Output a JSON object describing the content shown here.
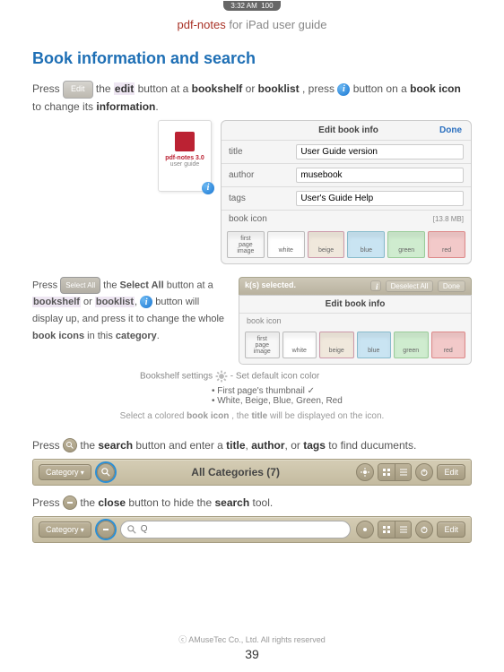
{
  "status_bar": {
    "time": "3:32 AM",
    "battery": "100"
  },
  "header": {
    "brand": "pdf-notes",
    "suffix": "for iPad user guide"
  },
  "section_title": "Book information and search",
  "p1": {
    "pre": "Press ",
    "chip": "Edit",
    "mid1": " the ",
    "b1": "edit",
    "mid2": " button at a ",
    "b2": "bookshelf",
    "mid3": " or ",
    "b3": "booklist",
    "mid4": ", press ",
    "mid5": " button on a ",
    "b4": "book icon",
    "mid6": " to change its ",
    "b5": "information",
    "end": "."
  },
  "thumb": {
    "line1": "pdf-notes 3.0",
    "line2": "user guide"
  },
  "edit_panel": {
    "title": "Edit book info",
    "done": "Done",
    "rows": {
      "title_label": "title",
      "title_value": "User Guide version",
      "author_label": "author",
      "author_value": "musebook",
      "tags_label": "tags",
      "tags_value": "User's Guide Help",
      "icon_label": "book icon",
      "filesize": "[13.8 MB]"
    },
    "swatches": {
      "first": "first\npage\nimage",
      "white": "white",
      "beige": "beige",
      "blue": "blue",
      "green": "green",
      "red": "red"
    }
  },
  "p2_chip": "Select All",
  "p2": {
    "t1": "Press ",
    "t2": " the ",
    "b1": "Select All",
    "t3": " button at a ",
    "b2": "bookshelf",
    "t4": " or ",
    "b3": "booklist",
    "t5": ", ",
    "t6": " button will display up, and press it to change the whole ",
    "b4": "book icons",
    "t7": " in this ",
    "b5": "category",
    "t8": "."
  },
  "mid_panel": {
    "selected": "k(s) selected.",
    "deselect": "Deselect All",
    "done": "Done",
    "title": "Edit book info",
    "row_label": "book icon"
  },
  "notes": {
    "line1a": "Bookshelf settings ",
    "line1b": " - Set default icon color",
    "bullet1": "• First page's thumbnail ✓",
    "bullet2": "• White, Beige, Blue, Green, Red",
    "hint_pre": "Select a colored ",
    "hint_b1": "book icon",
    "hint_mid": ", the ",
    "hint_b2": "title",
    "hint_post": " will be displayed on the icon."
  },
  "p3": {
    "t1": "Press ",
    "t2": " the ",
    "b1": "search",
    "t3": " button and enter a ",
    "b2": "title",
    "t4": ", ",
    "b3": "author",
    "t5": ", or ",
    "b4": "tags",
    "t6": " to find ducuments."
  },
  "toolbar1": {
    "category": "Category",
    "title": "All Categories (7)",
    "edit": "Edit"
  },
  "p4": {
    "t1": "Press ",
    "t2": " the ",
    "b1": "close",
    "t3": " button to hide the ",
    "b2": "search",
    "t4": " tool."
  },
  "toolbar2": {
    "category": "Category",
    "placeholder": "Q",
    "edit": "Edit"
  },
  "footer": {
    "copyright": "ⓒ AMuseTec Co., Ltd. All rights reserved",
    "page": "39"
  }
}
